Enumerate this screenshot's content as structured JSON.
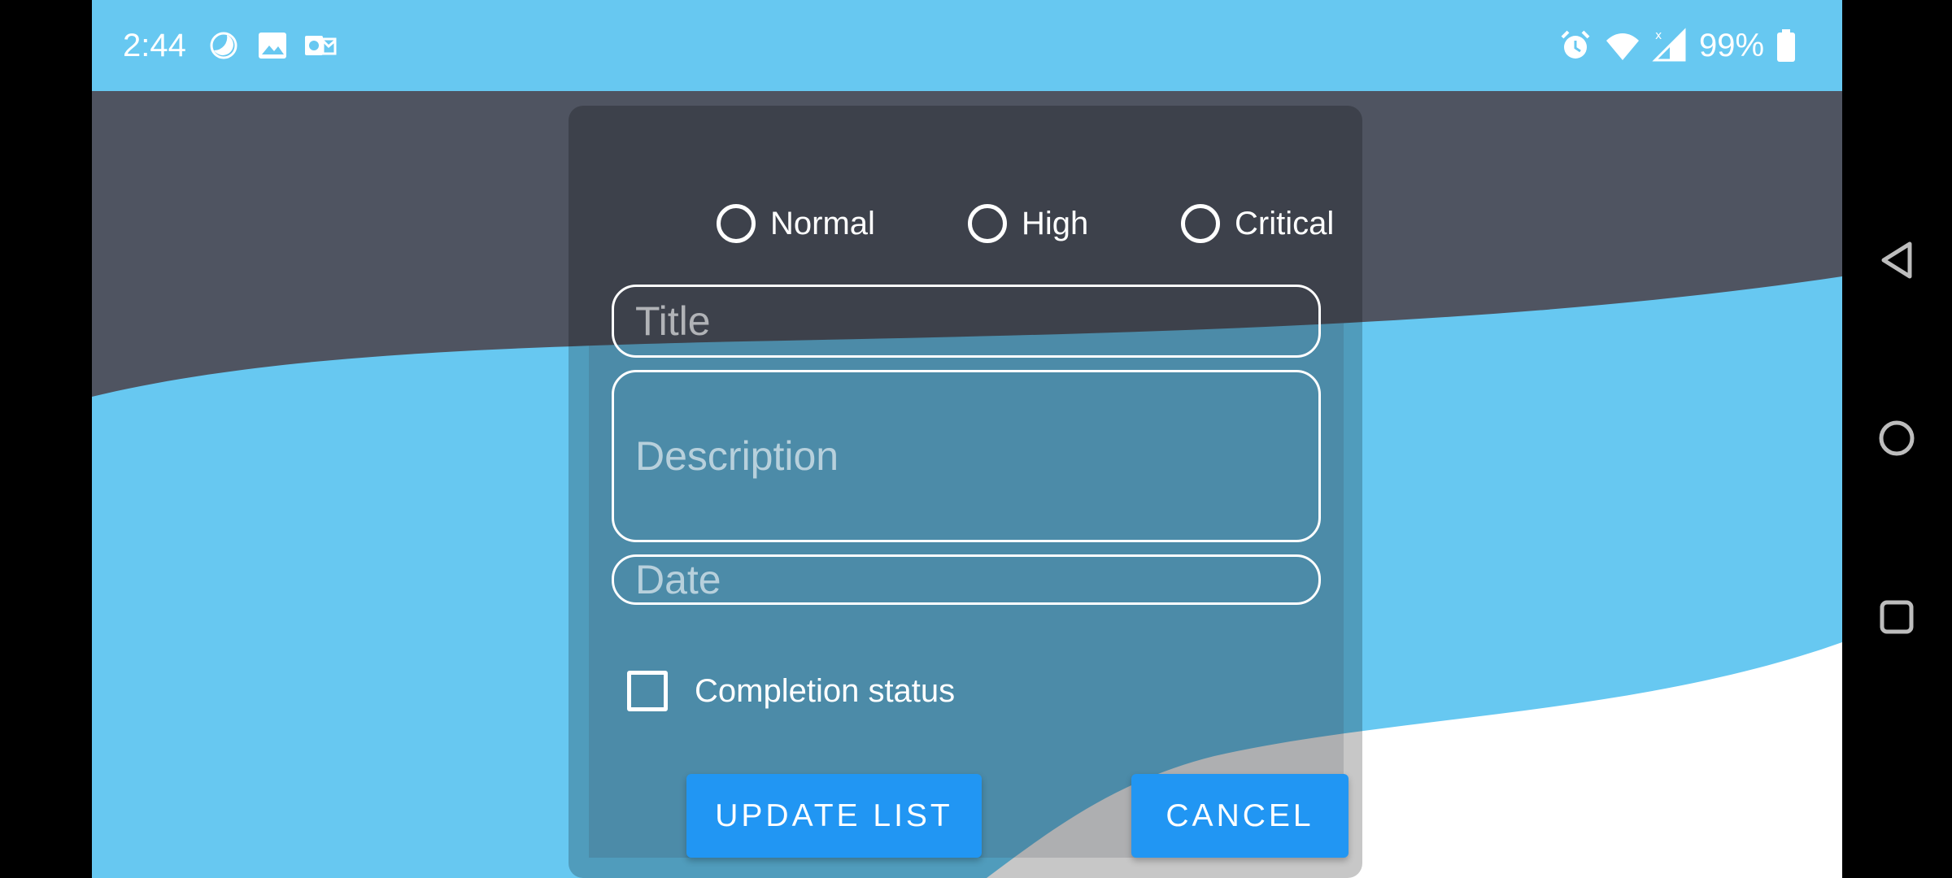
{
  "status_bar": {
    "time": "2:44",
    "battery": "99%",
    "icons": [
      "moon-icon",
      "image-icon",
      "outlook-icon",
      "alarm-icon",
      "wifi-icon",
      "signal-icon",
      "battery-icon"
    ]
  },
  "dialog": {
    "priority_options": [
      {
        "label": "Normal",
        "selected": false
      },
      {
        "label": "High",
        "selected": false
      },
      {
        "label": "Critical",
        "selected": false
      }
    ],
    "title_placeholder": "Title",
    "description_placeholder": "Description",
    "date_placeholder": "Date",
    "completion_label": "Completion status",
    "completion_checked": false,
    "update_button": "UPDATE LIST",
    "cancel_button": "CANCEL"
  },
  "nav_bar": {
    "buttons": [
      "back-icon",
      "home-icon",
      "recents-icon"
    ]
  },
  "colors": {
    "sky_blue": "#67c8f1",
    "dark_band": "#4f5461",
    "accent_button": "#2196f3"
  }
}
